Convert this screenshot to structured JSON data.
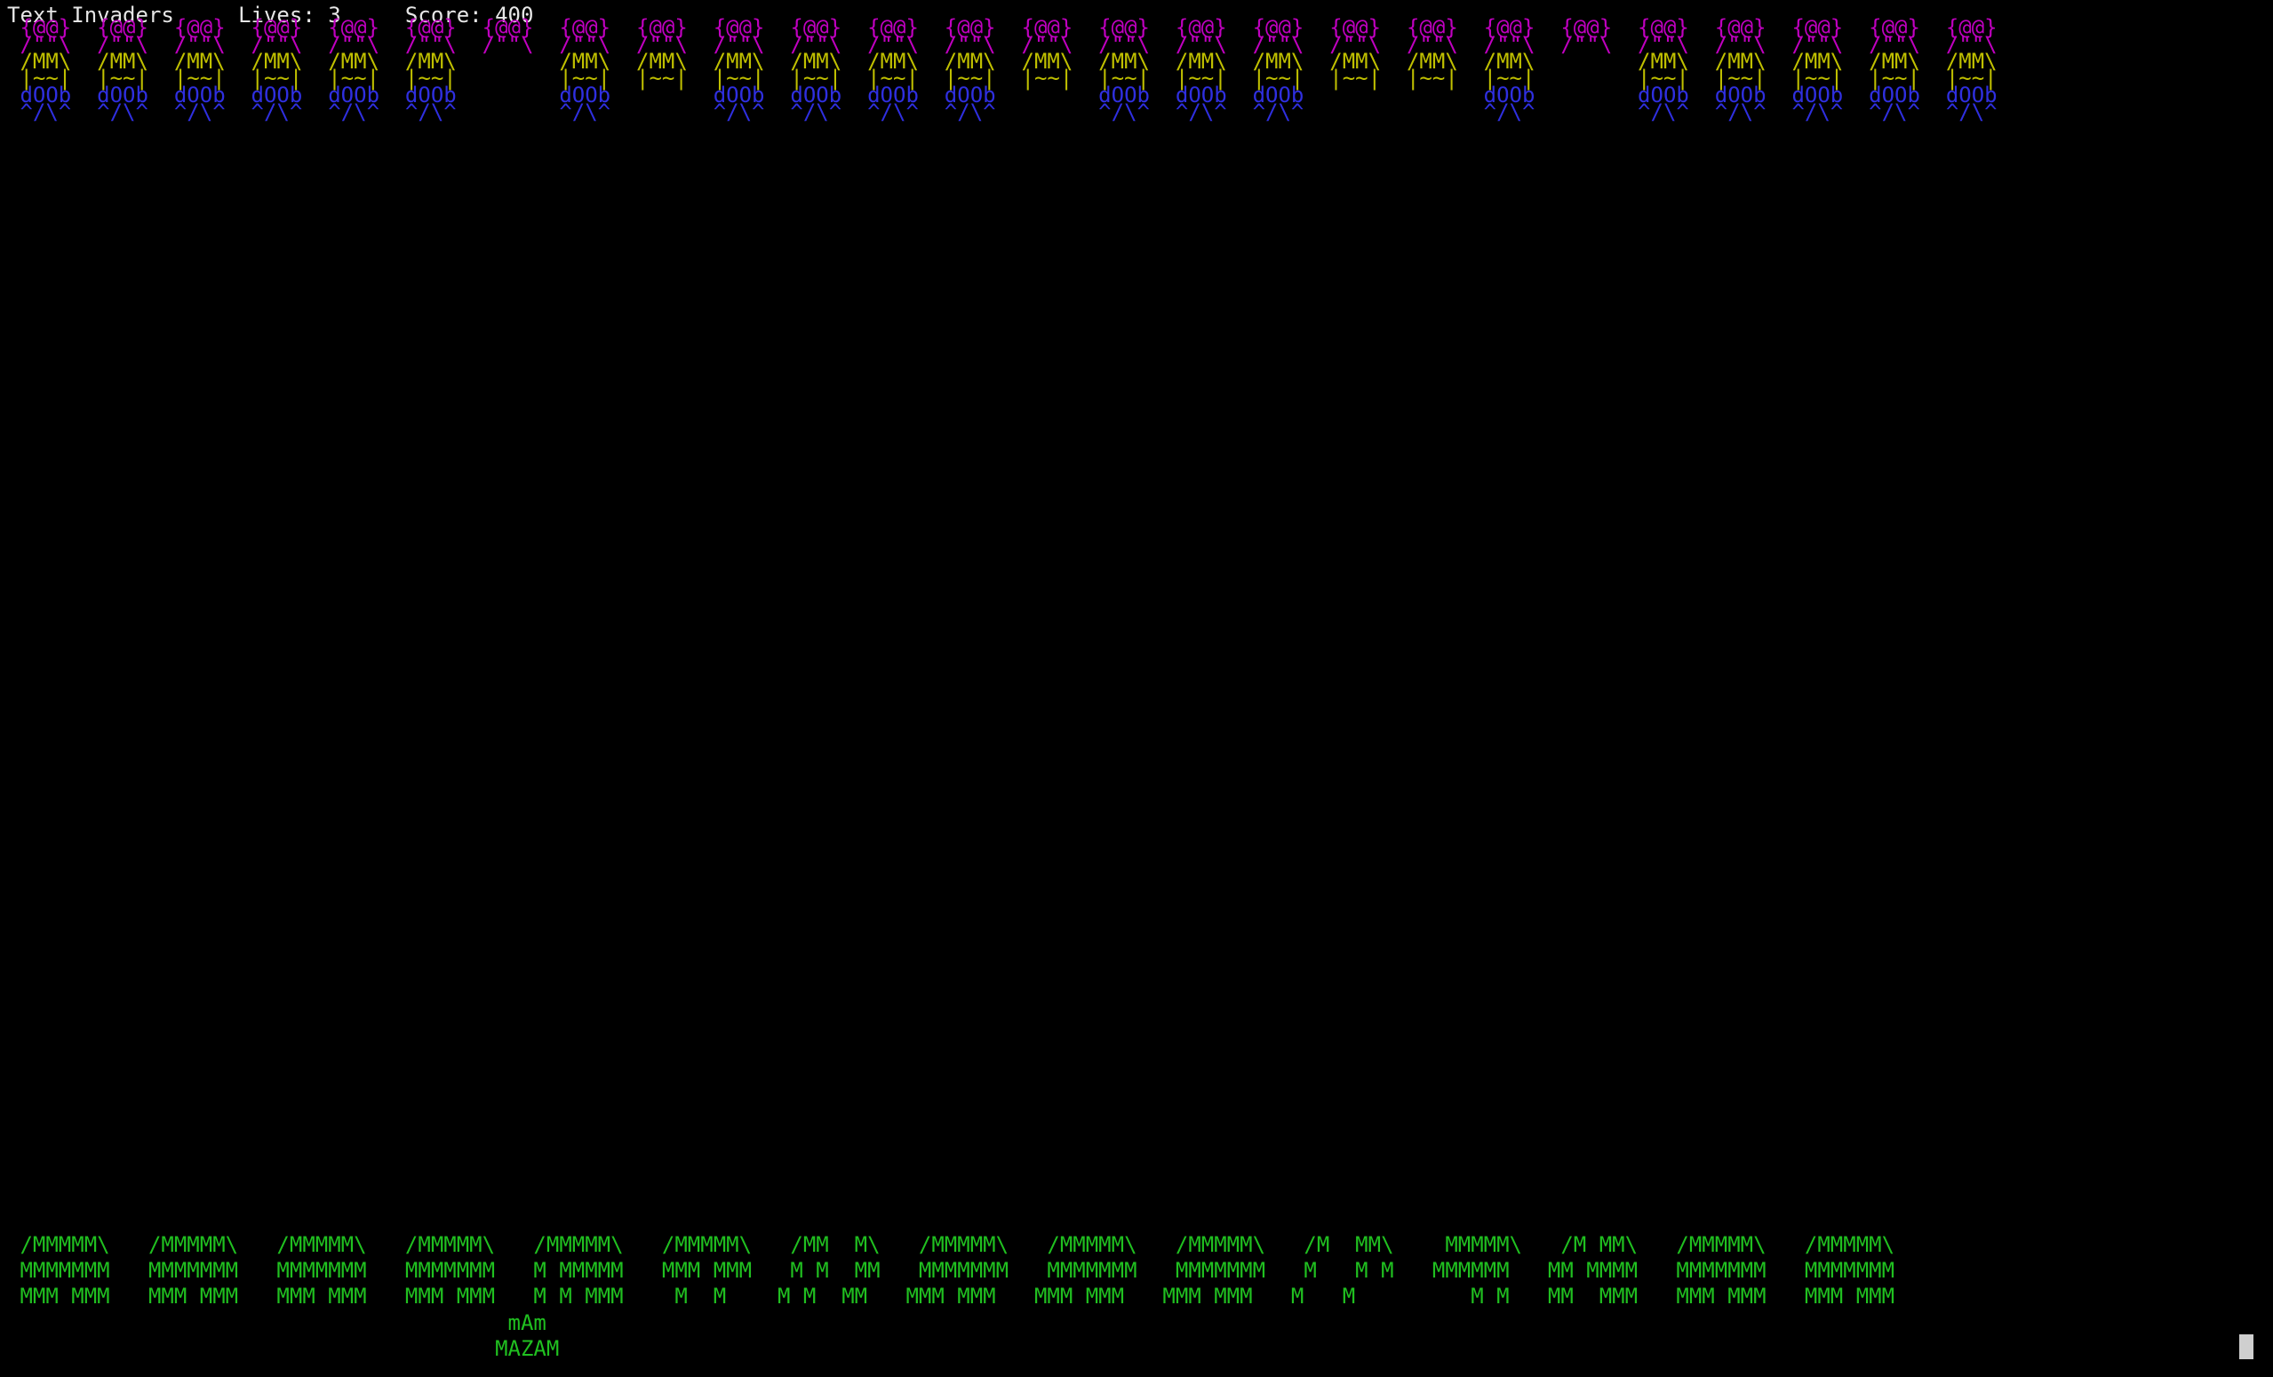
{
  "status": {
    "line": "Text Invaders     Lives: 3     Score: 400"
  },
  "colors": {
    "background": "#000000",
    "status_text": "#e6e6e6",
    "alien_head": "#c000c0",
    "alien_body": "#c0c000",
    "alien_legs": "#2f2fe0",
    "bunker": "#20c020",
    "player": "#20c020"
  },
  "aliens": {
    "row_heads": " {@@}  {@@}  {@@}  {@@}  {@@}  {@@}  {@@}  {@@}  {@@}  {@@}  {@@}  {@@}  {@@}  {@@}  {@@}  {@@}  {@@}  {@@}  {@@}  {@@}  {@@}  {@@}  {@@}  {@@}  {@@}  {@@}",
    "row_eyes": " /\"\"\\  /\"\"\\  /\"\"\\  /\"\"\\  /\"\"\\  /\"\"\\  /\"\"\\  /\"\"\\  /\"\"\\  /\"\"\\  /\"\"\\  /\"\"\\  /\"\"\\  /\"\"\\  /\"\"\\  /\"\"\\  /\"\"\\  /\"\"\\  /\"\"\\  /\"\"\\  /\"\"\\  /\"\"\\  /\"\"\\  /\"\"\\  /\"\"\\  /\"\"\\",
    "row_body": " /MM\\  /MM\\  /MM\\  /MM\\  /MM\\  /MM\\        /MM\\  /MM\\  /MM\\  /MM\\  /MM\\  /MM\\  /MM\\  /MM\\  /MM\\  /MM\\  /MM\\  /MM\\  /MM\\        /MM\\  /MM\\  /MM\\  /MM\\  /MM\\",
    "row_belly": " |~~|  |~~|  |~~|  |~~|  |~~|  |~~|        |~~|  |~~|  |~~|  |~~|  |~~|  |~~|  |~~|  |~~|  |~~|  |~~|  |~~|  |~~|  |~~|        |~~|  |~~|  |~~|  |~~|  |~~|",
    "row_legs": " dOOb  dOOb  dOOb  dOOb  dOOb  dOOb        dOOb        dOOb  dOOb  dOOb  dOOb        dOOb  dOOb  dOOb              dOOb        dOOb  dOOb  dOOb  dOOb  dOOb",
    "row_feet": " ^/\\^  ^/\\^  ^/\\^  ^/\\^  ^/\\^  ^/\\^        ^/\\^        ^/\\^  ^/\\^  ^/\\^  ^/\\^        ^/\\^  ^/\\^  ^/\\^              ^/\\^        ^/\\^  ^/\\^  ^/\\^  ^/\\^  ^/\\^"
  },
  "bunkers": {
    "row_1": " /MMMMM\\   /MMMMM\\   /MMMMM\\   /MMMMM\\   /MMMMM\\   /MMMMM\\   /MM  M\\   /MMMMM\\   /MMMMM\\   /MMMMM\\   /M  MM\\    MMMMM\\   /M MM\\   /MMMMM\\   /MMMMM\\",
    "row_2": " MMMMMMM   MMMMMMM   MMMMMMM   MMMMMMM   M MMMMM   MMM MMM   M M  MM   MMMMMMM   MMMMMMM   MMMMMMM   M   M M   MMMMMM   MM MMMM   MMMMMMM   MMMMMMM",
    "row_3": " MMM MMM   MMM MMM   MMM MMM   MMM MMM   M M MMM    M  M    M M  MM   MMM MMM   MMM MMM   MMM MMM   M   M         M M   MM  MMM   MMM MMM   MMM MMM"
  },
  "player": {
    "row_1": "                                       mAm",
    "row_2": "                                      MAZAM"
  },
  "cursor_icon": "block-cursor-icon"
}
